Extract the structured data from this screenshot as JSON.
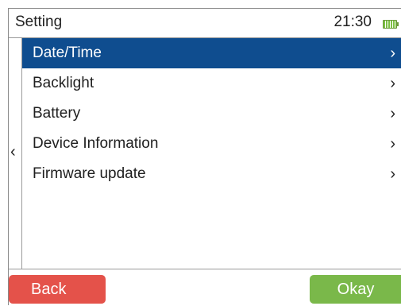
{
  "header": {
    "title": "Setting",
    "time": "21:30",
    "battery_icon": "battery-icon"
  },
  "menu": {
    "back_arrow": "‹",
    "items": [
      {
        "label": "Date/Time",
        "chevron": "›",
        "selected": true
      },
      {
        "label": "Backlight",
        "chevron": "›",
        "selected": false
      },
      {
        "label": "Battery",
        "chevron": "›",
        "selected": false
      },
      {
        "label": "Device Information",
        "chevron": "›",
        "selected": false
      },
      {
        "label": "Firmware update",
        "chevron": "›",
        "selected": false
      }
    ]
  },
  "footer": {
    "back_label": "Back",
    "okay_label": "Okay"
  },
  "colors": {
    "selected": "#0f4d8f",
    "back_button": "#e4524a",
    "okay_button": "#7ab84a",
    "battery": "#7dc043"
  }
}
